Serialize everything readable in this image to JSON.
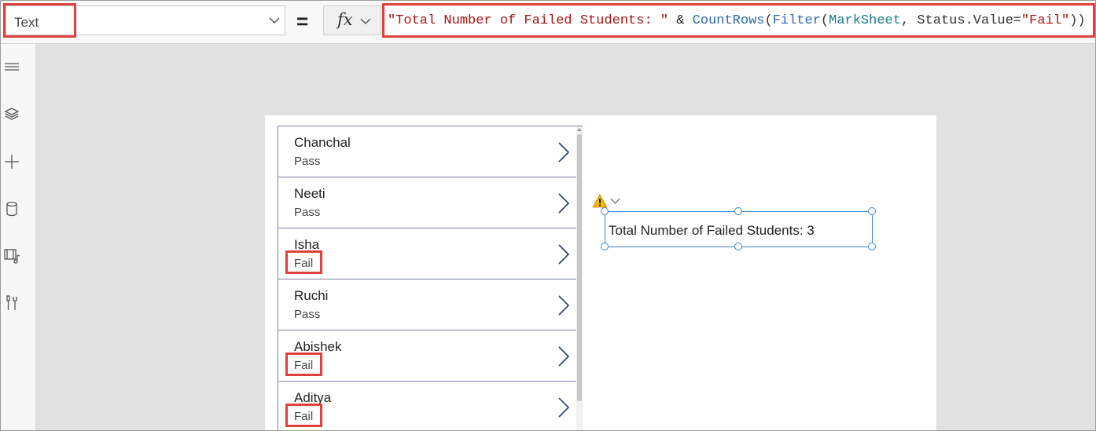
{
  "formula_bar": {
    "property": "Text",
    "equals": "=",
    "fx": "fx",
    "formula_tokens": [
      {
        "text": "\"Total Number of Failed Students: \"",
        "kind": "str"
      },
      {
        "text": " & ",
        "kind": "op"
      },
      {
        "text": "CountRows",
        "kind": "fn"
      },
      {
        "text": "(",
        "kind": "plain"
      },
      {
        "text": "Filter",
        "kind": "fn"
      },
      {
        "text": "(",
        "kind": "plain"
      },
      {
        "text": "MarkSheet",
        "kind": "ds"
      },
      {
        "text": ", Status.Value=",
        "kind": "plain"
      },
      {
        "text": "\"Fail\"",
        "kind": "str"
      },
      {
        "text": "))",
        "kind": "plain"
      }
    ]
  },
  "left_rail": {
    "icons": [
      "hamburger-icon",
      "layers-icon",
      "plus-icon",
      "data-icon",
      "media-icon",
      "tools-icon"
    ]
  },
  "gallery": {
    "items": [
      {
        "name": "Chanchal",
        "status": "Pass"
      },
      {
        "name": "Neeti",
        "status": "Pass"
      },
      {
        "name": "Isha",
        "status": "Fail"
      },
      {
        "name": "Ruchi",
        "status": "Pass"
      },
      {
        "name": "Abishek",
        "status": "Fail"
      },
      {
        "name": "Aditya",
        "status": "Fail"
      }
    ]
  },
  "label_control": {
    "text": "Total Number of Failed Students: 3"
  },
  "colors": {
    "highlight": "#e0413c",
    "selection": "#3c83c8",
    "warning": "#f2b600"
  }
}
